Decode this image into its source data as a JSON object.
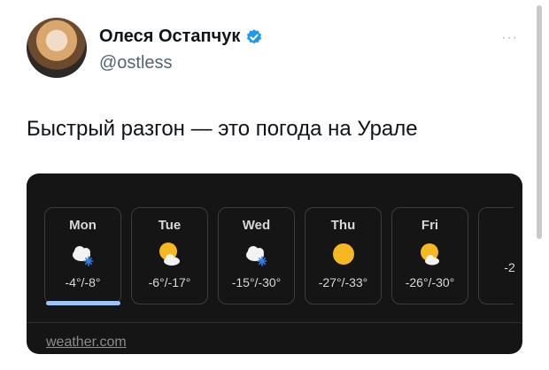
{
  "user": {
    "name": "Олеся Остапчук",
    "handle": "@ostless",
    "verified_icon": "verified-badge-icon",
    "more_label": "···"
  },
  "tweet": {
    "text": "Быстрый разгон — это погода на Урале"
  },
  "forecast": {
    "days": [
      {
        "day": "Mon",
        "icon": "snow-cloud-icon",
        "temp": "-4°/-8°",
        "selected": true
      },
      {
        "day": "Tue",
        "icon": "sun-cloud-icon",
        "temp": "-6°/-17°"
      },
      {
        "day": "Wed",
        "icon": "snow-cloud-icon",
        "temp": "-15°/-30°"
      },
      {
        "day": "Thu",
        "icon": "sun-icon",
        "temp": "-27°/-33°"
      },
      {
        "day": "Fri",
        "icon": "sun-cloud-icon",
        "temp": "-26°/-30°"
      },
      {
        "day": "",
        "icon": "",
        "temp": "-2"
      }
    ],
    "source": "weather.com"
  },
  "colors": {
    "verified": "#1d9bf0",
    "card_bg": "#151515",
    "selected_bar": "#9cc2f7",
    "sun": "#f5b820"
  }
}
